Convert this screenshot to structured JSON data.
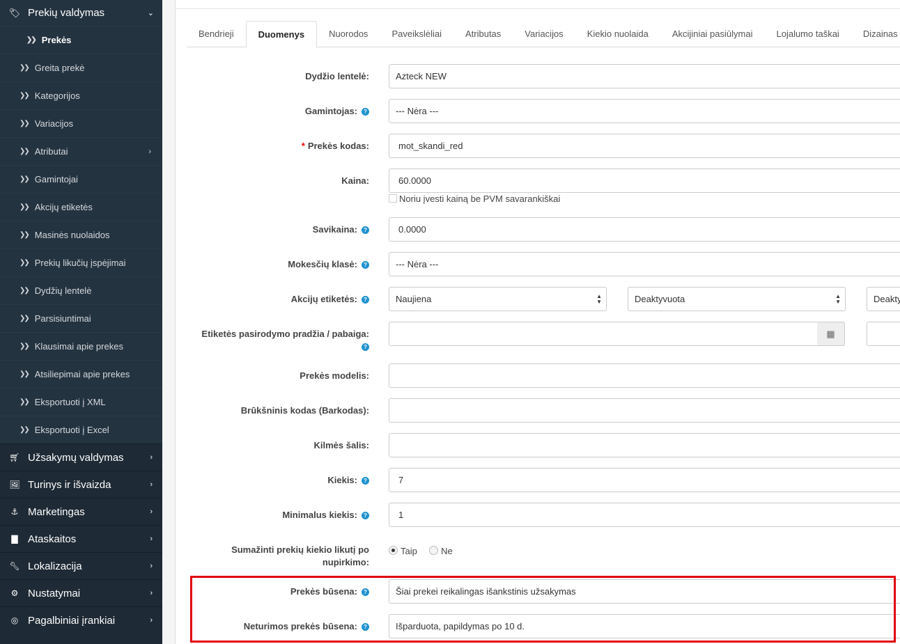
{
  "sidebar": {
    "header": {
      "label": "Prekių valdymas",
      "icon": "tags-icon"
    },
    "sub_items": [
      {
        "label": "Prekės"
      },
      {
        "label": "Greita prekė"
      },
      {
        "label": "Kategorijos"
      },
      {
        "label": "Variacijos"
      },
      {
        "label": "Atributai"
      },
      {
        "label": "Gamintojai"
      },
      {
        "label": "Akcijų etiketės"
      },
      {
        "label": "Masinės nuolaidos"
      },
      {
        "label": "Prekių likučių įspėjimai"
      },
      {
        "label": "Dydžių lentelė"
      },
      {
        "label": "Parsisiuntimai"
      },
      {
        "label": "Klausimai apie prekes"
      },
      {
        "label": "Atsiliepimai apie prekes"
      },
      {
        "label": "Eksportuoti į XML"
      },
      {
        "label": "Eksportuoti į Excel"
      }
    ],
    "main_items": [
      {
        "label": "Užsakymų valdymas",
        "icon": "cart-icon"
      },
      {
        "label": "Turinys ir išvaizda",
        "icon": "image-file-icon"
      },
      {
        "label": "Marketingas",
        "icon": "share-icon"
      },
      {
        "label": "Ataskaitos",
        "icon": "bar-chart-icon"
      },
      {
        "label": "Lokalizacija",
        "icon": "wrench-icon"
      },
      {
        "label": "Nustatymai",
        "icon": "gear-icon"
      },
      {
        "label": "Pagalbiniai įrankiai",
        "icon": "lifebuoy-icon"
      }
    ]
  },
  "tabs": [
    "Bendrieji",
    "Duomenys",
    "Nuorodos",
    "Paveikslėliai",
    "Atributas",
    "Variacijos",
    "Kiekio nuolaida",
    "Akcijiniai pasiūlymai",
    "Lojalumo taškai",
    "Dizainas"
  ],
  "active_tab": "Duomenys",
  "form": {
    "size_chart": {
      "label": "Dydžio lentelė:",
      "value": "Azteck NEW"
    },
    "manufacturer": {
      "label": "Gamintojas:",
      "value": "--- Nėra ---"
    },
    "product_code": {
      "label": "Prekės kodas:",
      "required_mark": "*",
      "value": "mot_skandi_red"
    },
    "price": {
      "label": "Kaina:",
      "value": "60.0000",
      "checkbox_label": "Noriu įvesti kainą be PVM savarankiškai"
    },
    "cost": {
      "label": "Savikaina:",
      "value": "0.0000"
    },
    "tax_class": {
      "label": "Mokesčių klasė:",
      "value": "--- Nėra ---"
    },
    "promo_labels": {
      "label": "Akcijų etiketės:",
      "select1": "Naujiena",
      "select2": "Deaktyvuota",
      "select3": "Deaktyvuota"
    },
    "label_dates": {
      "label": "Etiketės pasirodymo pradžia / pabaiga:",
      "calendar_icon": "calendar-icon"
    },
    "model": {
      "label": "Prekės modelis:",
      "value": ""
    },
    "barcode": {
      "label": "Brūkšninis kodas (Barkodas):",
      "value": ""
    },
    "origin": {
      "label": "Kilmės šalis:",
      "value": ""
    },
    "quantity": {
      "label": "Kiekis:",
      "value": "7"
    },
    "min_quantity": {
      "label": "Minimalus kiekis:",
      "value": "1"
    },
    "subtract_stock": {
      "label": "Sumažinti prekių kiekio likutį po nupirkimo:",
      "yes": "Taip",
      "no": "Ne",
      "selected": "Taip"
    },
    "stock_status": {
      "label": "Prekės būsena:",
      "value": "Šiai prekei reikalingas išankstinis užsakymas"
    },
    "out_of_stock_status": {
      "label": "Neturimos prekės būsena:",
      "value": "Išparduota, papildymas po 10 d."
    }
  },
  "colors": {
    "sidebar_bg": "#1e2a35",
    "help_icon": "#1e91cf",
    "highlight": "#e3000f",
    "required": "#e00000"
  }
}
